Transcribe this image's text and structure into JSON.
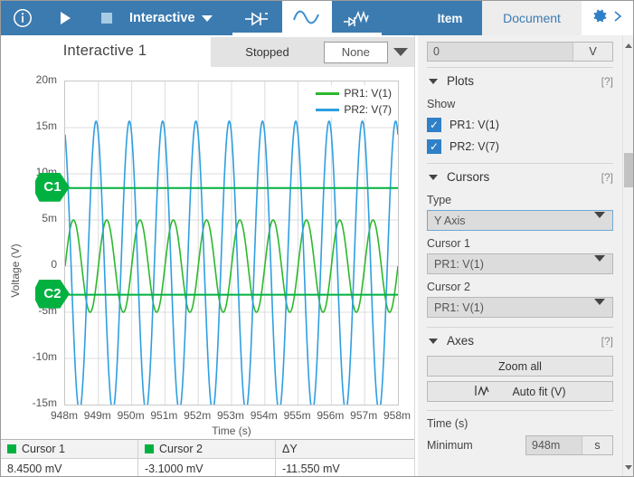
{
  "toolbar": {
    "info_icon": "info-circle-icon",
    "play_icon": "play-icon",
    "stop_icon": "stop-icon",
    "mode_label": "Interactive",
    "tabs": [
      {
        "name": "dc-sweep-tab",
        "icon": "diode-arrow-icon",
        "active": false
      },
      {
        "name": "transient-tab",
        "icon": "sine-wave-icon",
        "active": true
      },
      {
        "name": "mixed-signal-tab",
        "icon": "mixed-signal-icon",
        "active": false
      }
    ]
  },
  "subheader": {
    "plot_title": "Interactive 1",
    "status": "Stopped",
    "cursor_select_value": "None"
  },
  "chart_data": {
    "type": "line",
    "title": "Interactive 1",
    "xlabel": "Time (s)",
    "ylabel": "Voltage (V)",
    "xlim": [
      0.948,
      0.958
    ],
    "ylim": [
      -0.015,
      0.02
    ],
    "xticks": [
      "948m",
      "949m",
      "950m",
      "951m",
      "952m",
      "953m",
      "954m",
      "955m",
      "956m",
      "957m",
      "958m"
    ],
    "yticks": [
      "20m",
      "15m",
      "10m",
      "5m",
      "0",
      "-5m",
      "-10m",
      "-15m"
    ],
    "ytick_values": [
      0.02,
      0.015,
      0.01,
      0.005,
      0.0,
      -0.005,
      -0.01,
      -0.015
    ],
    "grid": true,
    "legend_position": "top-right",
    "series": [
      {
        "name": "PR1: V(1)",
        "color": "#2cb82c",
        "amplitude_v": 0.005,
        "offset_v": 0.0,
        "frequency_hz": 1000,
        "phase_deg": 0,
        "description": "Green sine, 5 mV peak, 1 kHz, ~10 cycles across window"
      },
      {
        "name": "PR2: V(7)",
        "color": "#2f9fe0",
        "amplitude_v": 0.0157,
        "offset_v": 0.0,
        "frequency_hz": 1000,
        "phase_deg": 115,
        "description": "Blue sine, ~15.7 mV peak, 1 kHz, narrow-looking peaks, ~10 cycles"
      }
    ],
    "cursors": [
      {
        "label": "C1",
        "color": "#00b140",
        "y_value_v": 0.00845,
        "y_text": "8.4500 mV"
      },
      {
        "label": "C2",
        "color": "#00b140",
        "y_value_v": -0.0031,
        "y_text": "-3.1000 mV"
      }
    ]
  },
  "cursor_table": {
    "headers": [
      "Cursor 1",
      "Cursor 2",
      "ΔY"
    ],
    "values": [
      "8.4500 mV",
      "-3.1000 mV",
      "-11.550 mV"
    ],
    "marker_color": "#00b140"
  },
  "right_panel": {
    "tabs": [
      {
        "label": "Item",
        "active": true
      },
      {
        "label": "Document",
        "active": false
      }
    ],
    "gear_icon": "gear-icon",
    "expand_icon": "chevron-right-icon",
    "top_field": {
      "value": "0",
      "unit": "V"
    },
    "sections": [
      {
        "title": "Plots",
        "help": "[?]",
        "show_label": "Show",
        "checkboxes": [
          {
            "label": "PR1: V(1)",
            "checked": true
          },
          {
            "label": "PR2: V(7)",
            "checked": true
          }
        ]
      },
      {
        "title": "Cursors",
        "help": "[?]",
        "fields": [
          {
            "label": "Type",
            "value": "Y Axis"
          },
          {
            "label": "Cursor 1",
            "value": "PR1: V(1)"
          },
          {
            "label": "Cursor 2",
            "value": "PR1: V(1)"
          }
        ]
      },
      {
        "title": "Axes",
        "help": "[?]",
        "buttons": [
          {
            "label": "Zoom all",
            "icon": ""
          },
          {
            "label": "Auto fit (V)",
            "icon": "autofit-icon"
          }
        ],
        "axis_group_label": "Time (s)",
        "minimum_label": "Minimum",
        "minimum_value": "948m",
        "minimum_unit": "s"
      }
    ]
  }
}
